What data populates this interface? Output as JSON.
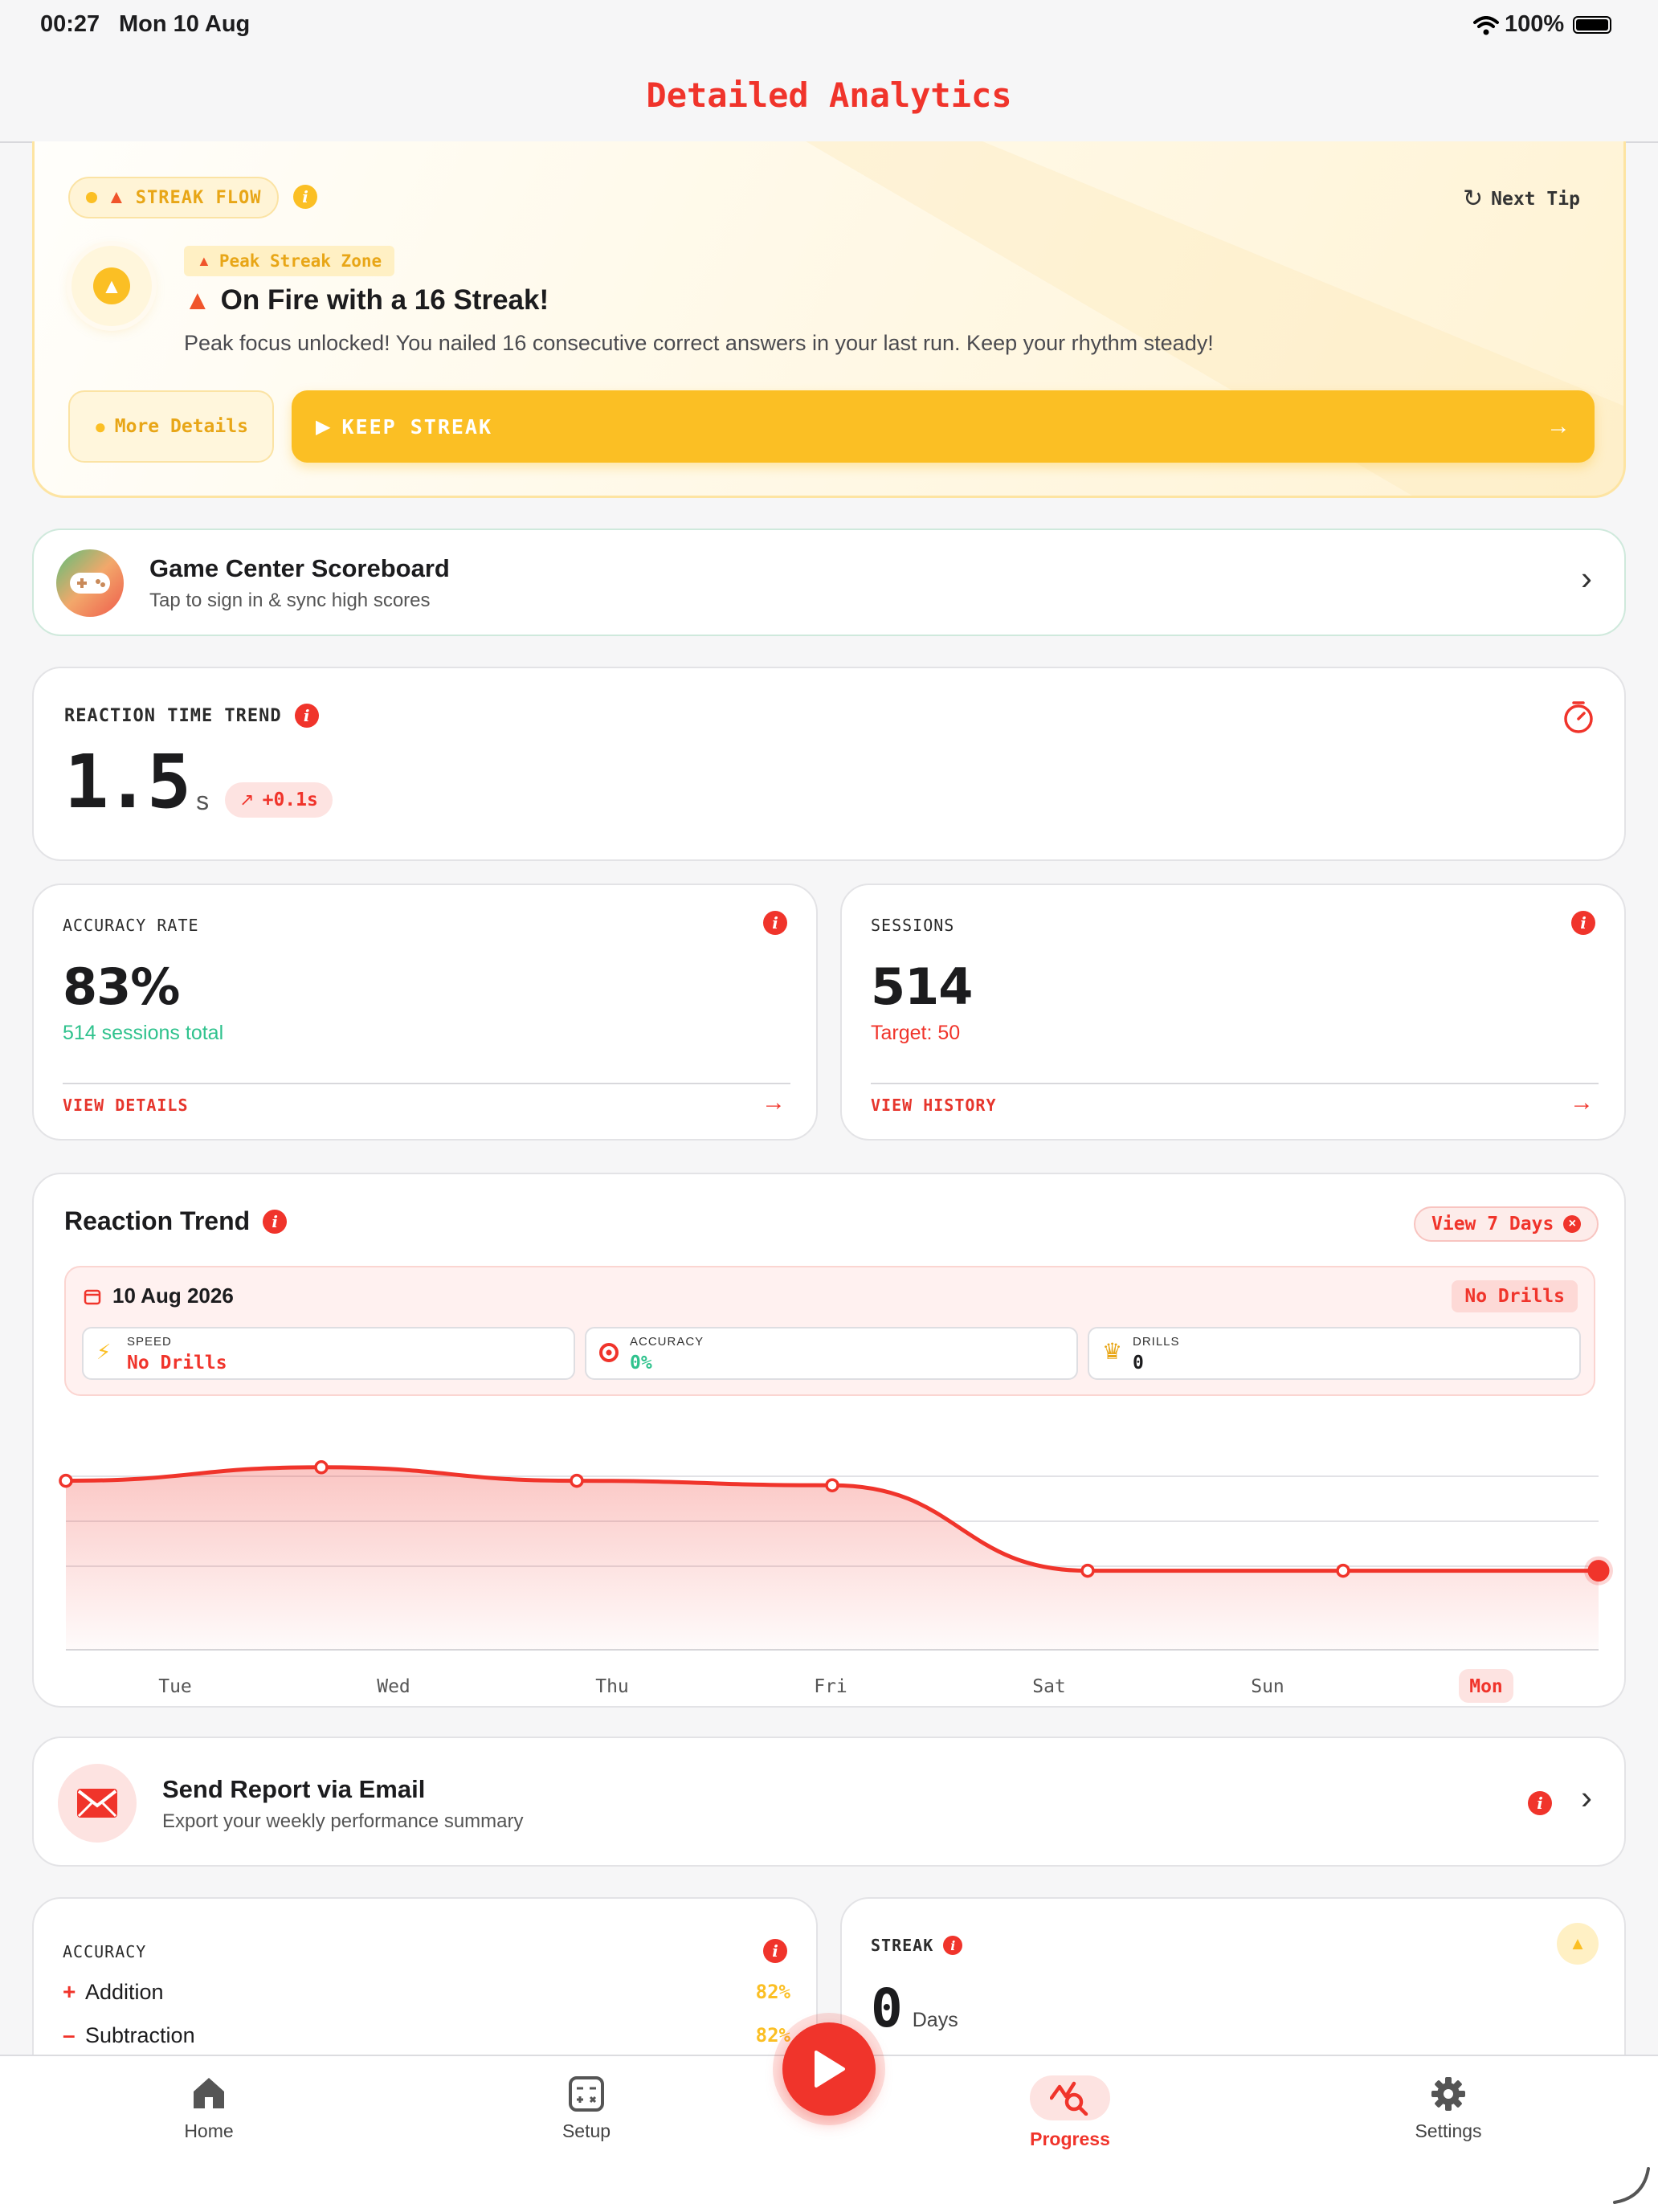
{
  "status_bar": {
    "time": "00:27",
    "date": "Mon 10 Aug",
    "battery": "100%"
  },
  "header": {
    "title": "Detailed Analytics"
  },
  "streak_card": {
    "badge": "STREAK FLOW",
    "next_tip": "Next Tip",
    "zone_label": "Peak Streak Zone",
    "headline": "On Fire with a 16 Streak!",
    "description": "Peak focus unlocked! You nailed 16 consecutive correct answers in your last run. Keep your rhythm steady!",
    "more_details": "More Details",
    "keep_streak": "KEEP STREAK"
  },
  "game_center": {
    "title": "Game Center Scoreboard",
    "subtitle": "Tap to sign in & sync high scores"
  },
  "reaction_time": {
    "label": "REACTION TIME TREND",
    "value": "1.5",
    "unit": "s",
    "delta": "+0.1s"
  },
  "accuracy_rate": {
    "label": "ACCURACY RATE",
    "value": "83%",
    "sub": "514 sessions total",
    "link": "VIEW DETAILS"
  },
  "sessions": {
    "label": "SESSIONS",
    "value": "514",
    "sub": "Target: 50",
    "link": "VIEW HISTORY"
  },
  "reaction_trend": {
    "title": "Reaction Trend",
    "view_button": "View 7 Days",
    "date": "10 Aug 2026",
    "no_drills_badge": "No Drills",
    "metrics": [
      {
        "label": "SPEED",
        "value": "No Drills"
      },
      {
        "label": "ACCURACY",
        "value": "0%"
      },
      {
        "label": "DRILLS",
        "value": "0"
      }
    ]
  },
  "chart_data": {
    "type": "line",
    "categories": [
      "Tue",
      "Wed",
      "Thu",
      "Fri",
      "Sat",
      "Sun",
      "Mon"
    ],
    "values": [
      2.9,
      3.2,
      2.9,
      2.8,
      0.9,
      0.9,
      0.9
    ],
    "ylim": [
      0,
      4
    ],
    "highlight": "Mon",
    "grid": true,
    "colors": {
      "line": "#f0342b"
    }
  },
  "email_report": {
    "title": "Send Report via Email",
    "subtitle": "Export your weekly performance summary"
  },
  "accuracy_card": {
    "label": "ACCURACY",
    "rows": [
      {
        "sign": "+",
        "name": "Addition",
        "value": "82%"
      },
      {
        "sign": "–",
        "name": "Subtraction",
        "value": "82%"
      }
    ]
  },
  "streak_stat": {
    "label": "STREAK",
    "value": "0",
    "unit": "Days"
  },
  "tab_bar": {
    "items": [
      {
        "label": "Home",
        "icon": "house-icon"
      },
      {
        "label": "Setup",
        "icon": "calculator-icon"
      },
      {
        "label": "Progress",
        "icon": "chart-search-icon"
      },
      {
        "label": "Settings",
        "icon": "gear-icon"
      }
    ]
  },
  "theme": {
    "accent": "#f0342b",
    "yellow": "#fbbf24",
    "green": "#2fc28d"
  }
}
